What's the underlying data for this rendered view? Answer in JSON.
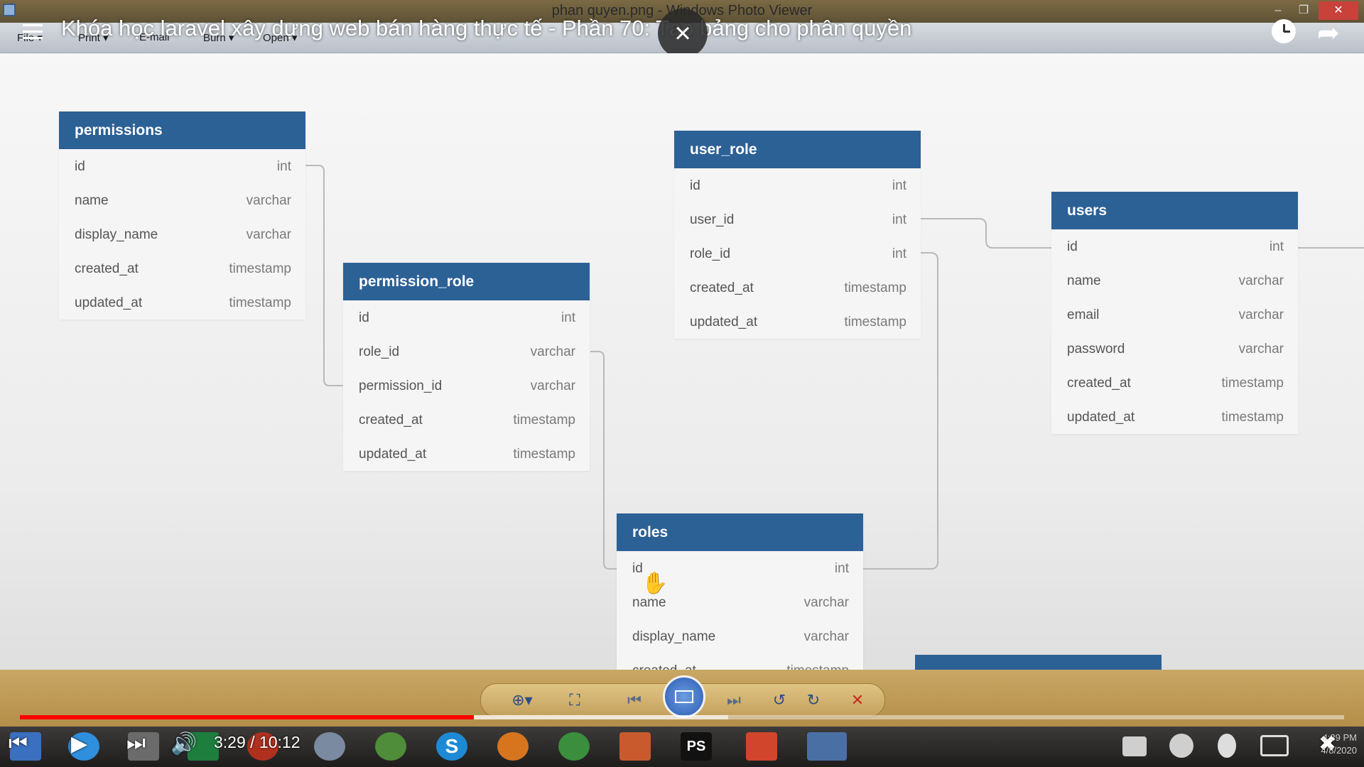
{
  "window": {
    "title": "phan quyen.png - Windows Photo Viewer",
    "min_icon": "minimize-icon",
    "max_icon": "restore-icon",
    "close_label": "✕"
  },
  "menu": {
    "items": [
      "File ▾",
      "Print ▾",
      "E-mail",
      "Burn ▾",
      "Open ▾"
    ]
  },
  "video": {
    "title": "Khóa học laravel xây dựng web bán hàng thực tế - Phần 70: Tạo bảng cho phân quyền",
    "time": "3:29 / 10:12",
    "progress_fraction": 0.343,
    "buffer_fraction": 0.535
  },
  "tables": {
    "permissions": {
      "name": "permissions",
      "rows": [
        {
          "field": "id",
          "type": "int"
        },
        {
          "field": "name",
          "type": "varchar"
        },
        {
          "field": "display_name",
          "type": "varchar"
        },
        {
          "field": "created_at",
          "type": "timestamp"
        },
        {
          "field": "updated_at",
          "type": "timestamp"
        }
      ]
    },
    "permission_role": {
      "name": "permission_role",
      "rows": [
        {
          "field": "id",
          "type": "int"
        },
        {
          "field": "role_id",
          "type": "varchar"
        },
        {
          "field": "permission_id",
          "type": "varchar"
        },
        {
          "field": "created_at",
          "type": "timestamp"
        },
        {
          "field": "updated_at",
          "type": "timestamp"
        }
      ]
    },
    "user_role": {
      "name": "user_role",
      "rows": [
        {
          "field": "id",
          "type": "int"
        },
        {
          "field": "user_id",
          "type": "int"
        },
        {
          "field": "role_id",
          "type": "int"
        },
        {
          "field": "created_at",
          "type": "timestamp"
        },
        {
          "field": "updated_at",
          "type": "timestamp"
        }
      ]
    },
    "users": {
      "name": "users",
      "rows": [
        {
          "field": "id",
          "type": "int"
        },
        {
          "field": "name",
          "type": "varchar"
        },
        {
          "field": "email",
          "type": "varchar"
        },
        {
          "field": "password",
          "type": "varchar"
        },
        {
          "field": "created_at",
          "type": "timestamp"
        },
        {
          "field": "updated_at",
          "type": "timestamp"
        }
      ]
    },
    "roles": {
      "name": "roles",
      "rows": [
        {
          "field": "id",
          "type": "int"
        },
        {
          "field": "name",
          "type": "varchar"
        },
        {
          "field": "display_name",
          "type": "varchar"
        },
        {
          "field": "created_at",
          "type": "timestamp"
        }
      ]
    }
  },
  "viewer_toolbar": {
    "zoom": "⊕▾",
    "fit": "⛶",
    "prev": "⏮",
    "next": "⏭",
    "rotate_ccw": "↺",
    "rotate_cw": "↻",
    "delete": "✕"
  },
  "colors": {
    "table_header": "#2c6196",
    "progress": "#ff0000",
    "viewer_bar": "#c9a764"
  },
  "taskbar": {
    "clock_time": "4:39 PM",
    "clock_date": "4/8/2020"
  }
}
